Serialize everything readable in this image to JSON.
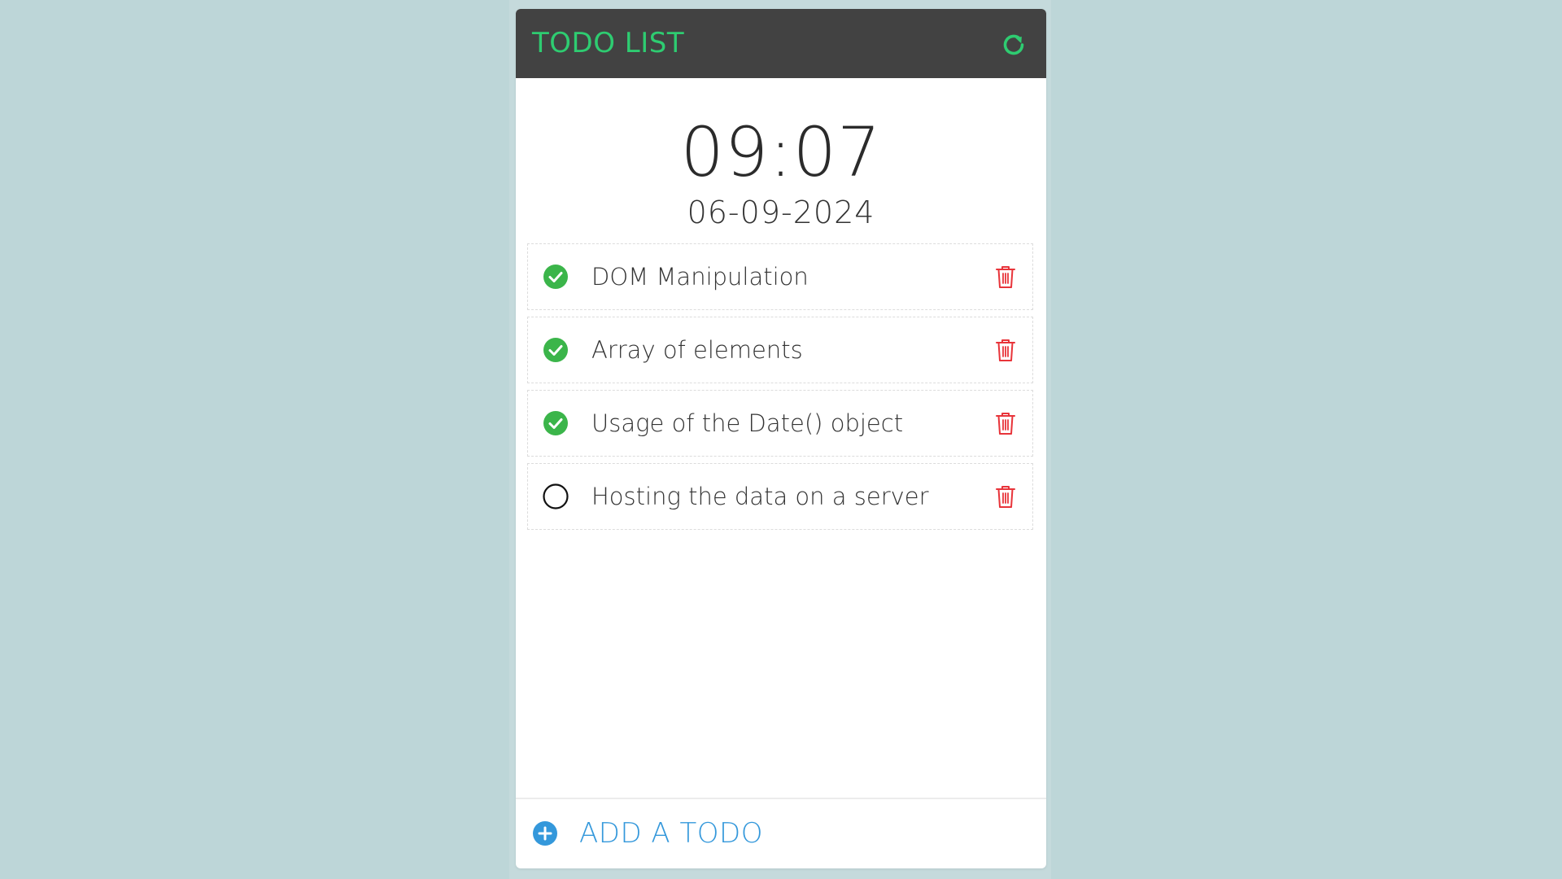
{
  "header": {
    "title": "TODO LIST",
    "refresh_icon": "refresh-icon",
    "accent_color": "#2ecc71"
  },
  "clock": {
    "time": "09:07",
    "date": "06-09-2024"
  },
  "todos": [
    {
      "text": "DOM Manipulation",
      "done": true
    },
    {
      "text": "Array of elements",
      "done": true
    },
    {
      "text": "Usage of the Date() object",
      "done": true
    },
    {
      "text": "Hosting the data on a server",
      "done": false
    }
  ],
  "footer": {
    "add_label": "ADD A TODO",
    "add_icon": "plus-circle-icon",
    "color": "#3498db"
  },
  "colors": {
    "check": "#3bb54a",
    "delete": "#e8343a",
    "header_bg": "#424242",
    "page_bg": "#bdd6d8"
  }
}
